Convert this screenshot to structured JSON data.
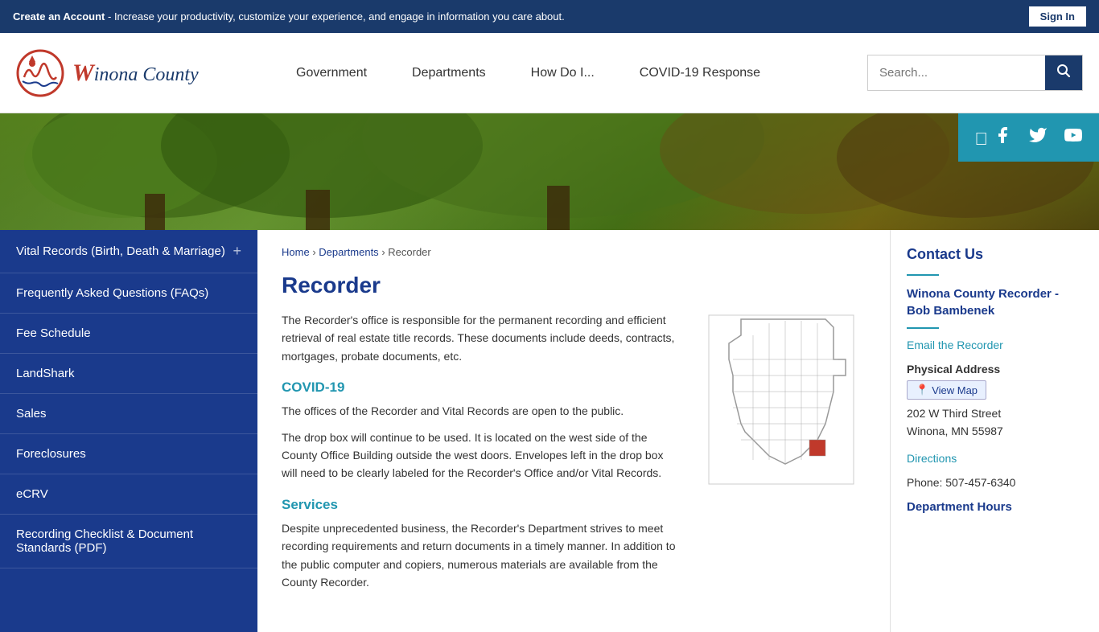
{
  "topBanner": {
    "createAccountText": "Create an Account",
    "bannerText": " - Increase your productivity, customize your experience, and engage in information you care about.",
    "signInLabel": "Sign In"
  },
  "header": {
    "logoTextPart1": "W",
    "logoTextFull": "inona County",
    "nav": {
      "items": [
        {
          "label": "Government"
        },
        {
          "label": "Departments"
        },
        {
          "label": "How Do I..."
        },
        {
          "label": "COVID-19 Response"
        }
      ]
    },
    "searchPlaceholder": "Search..."
  },
  "social": {
    "icons": [
      "facebook",
      "twitter",
      "youtube"
    ]
  },
  "sidebar": {
    "items": [
      {
        "label": "Vital Records (Birth, Death & Marriage)",
        "hasPlus": true
      },
      {
        "label": "Frequently Asked Questions (FAQs)",
        "hasPlus": false
      },
      {
        "label": "Fee Schedule",
        "hasPlus": false
      },
      {
        "label": "LandShark",
        "hasPlus": false
      },
      {
        "label": "Sales",
        "hasPlus": false
      },
      {
        "label": "Foreclosures",
        "hasPlus": false
      },
      {
        "label": "eCRV",
        "hasPlus": false
      },
      {
        "label": "Recording Checklist & Document Standards (PDF)",
        "hasPlus": false
      }
    ]
  },
  "breadcrumb": {
    "home": "Home",
    "departments": "Departments",
    "current": "Recorder"
  },
  "main": {
    "title": "Recorder",
    "intro": "The Recorder's office is responsible for the permanent recording and efficient retrieval of real estate title records. These documents include deeds, contracts, mortgages, probate documents, etc.",
    "covid19Title": "COVID-19",
    "covid19Text1": "The offices of the Recorder and Vital Records are open to the public.",
    "covid19Text2": "The drop box will continue to be used. It is located on the west side of the County Office Building outside the west doors. Envelopes left in the drop box will need to be clearly labeled for the Recorder's Office and/or Vital Records.",
    "servicesTitle": "Services",
    "servicesText": "Despite unprecedented business, the Recorder's Department strives to meet recording requirements and return documents in a timely manner. In addition to the public computer and copiers, numerous materials are available from the County Recorder."
  },
  "contactUs": {
    "title": "Contact Us",
    "name": "Winona County Recorder - Bob Bambenek",
    "emailLabel": "Email the Recorder",
    "physicalAddressLabel": "Physical Address",
    "viewMapLabel": "View Map",
    "address1": "202 W Third Street",
    "address2": "Winona, MN 55987",
    "directionsLabel": "Directions",
    "phone": "Phone: 507-457-6340",
    "deptHoursTitle": "Department Hours"
  }
}
